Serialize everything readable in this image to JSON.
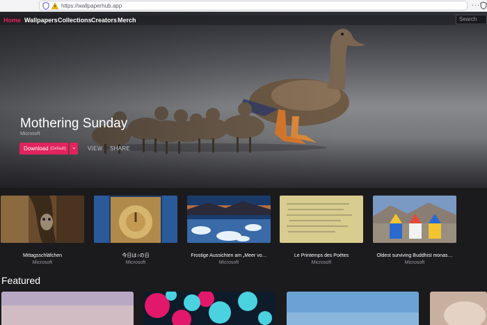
{
  "browser": {
    "url": "https://wallpaperhub.app",
    "menu_glyph": "···"
  },
  "nav": {
    "items": [
      {
        "label": "Home",
        "active": true
      },
      {
        "label": "Wallpapers"
      },
      {
        "label": "Collections"
      },
      {
        "label": "Creators"
      },
      {
        "label": "Merch"
      }
    ],
    "search_placeholder": "Search"
  },
  "hero": {
    "title": "Mothering Sunday",
    "author": "Microsoft",
    "download_label": "Download",
    "download_tag": "(Default)",
    "caret": "⌄",
    "view_label": "VIEW",
    "share_label": "SHARE"
  },
  "wallpapers": [
    {
      "title": "Mittagsschläfchen",
      "author": "Microsoft"
    },
    {
      "title": "今日は○の日",
      "author": "Microsoft"
    },
    {
      "title": "Frostige Aussichten am „Meer vo…",
      "author": "Microsoft"
    },
    {
      "title": "Le Printemps des Poètes",
      "author": "Microsoft"
    },
    {
      "title": "Oldest surviving Buddhist monas…",
      "author": "Microsoft"
    }
  ],
  "featured_heading": "Featured",
  "colors": {
    "accent": "#e0245e",
    "background": "#1b1b1d"
  }
}
